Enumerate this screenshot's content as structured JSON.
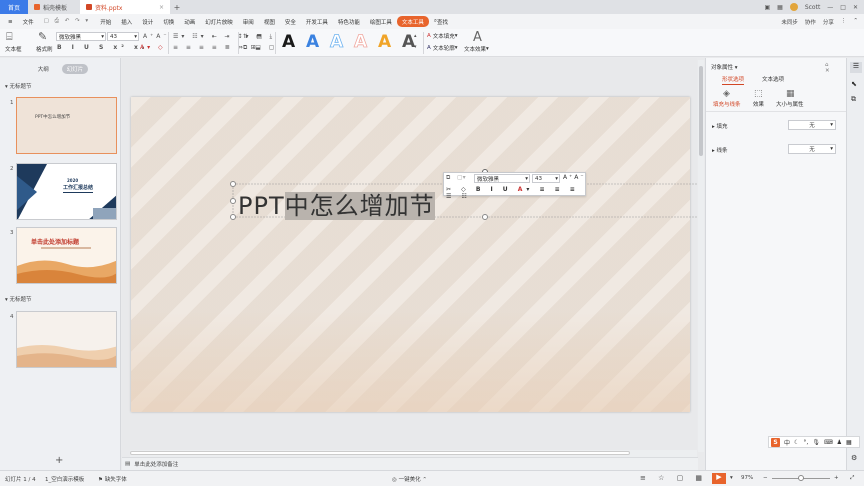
{
  "tabs": {
    "home": "首页",
    "template": "稻壳模板",
    "doc": "资料.pptx",
    "plus": "+"
  },
  "account": {
    "user": "Scott"
  },
  "menu": {
    "file": "文件",
    "items": [
      "开始",
      "插入",
      "设计",
      "切换",
      "动画",
      "幻灯片放映",
      "审阅",
      "视图",
      "安全",
      "开发工具",
      "特色功能",
      "绘图工具"
    ],
    "active": "文本工具",
    "search": "查找",
    "collab": "未同步",
    "cowork": "协作",
    "share": "分享"
  },
  "ribbon": {
    "textbox": "文本框",
    "format_painter": "格式刷",
    "font_name": "微软雅黑",
    "font_size": "43",
    "text_fill": "文本填充",
    "text_outline": "文本轮廓",
    "text_effect": "文本效果",
    "wordart_letter": "A",
    "wordart_colors": [
      "#1a1a1a",
      "#3b82e0",
      "#6fb3f0",
      "#f0a8a0",
      "#f0a428",
      "#555555"
    ]
  },
  "left_panel": {
    "outline_tab": "大纲",
    "slides_tab": "幻灯片",
    "section1": "无标题节",
    "section2": "无标题节",
    "slide1_title": "PPT中怎么增加节",
    "slide2_year": "2020",
    "slide2_title": "工作汇报总结",
    "slide3_title": "单击此处添加标题",
    "numbers": [
      "1",
      "2",
      "3",
      "4"
    ]
  },
  "slide": {
    "title_plain": "PPT",
    "title_selected": "中怎么增加节"
  },
  "mini_toolbar": {
    "font": "微软雅黑",
    "size": "43"
  },
  "notes": {
    "placeholder": "单击此处添加备注"
  },
  "right_panel": {
    "title": "对象属性",
    "shape_tab": "形状选项",
    "text_tab": "文本选项",
    "fill_line": "填充与线条",
    "effects": "效果",
    "size_props": "大小与属性",
    "fill": "填充",
    "line": "线条",
    "fill_value": "无",
    "line_value": "无"
  },
  "status": {
    "slide_index": "幻灯片 1 / 4",
    "theme": "1_空白演示模板",
    "font_missing": "缺失字体",
    "beautify": "一键美化",
    "zoom": "97%"
  },
  "ime": {
    "s": "S",
    "lang": "中"
  }
}
